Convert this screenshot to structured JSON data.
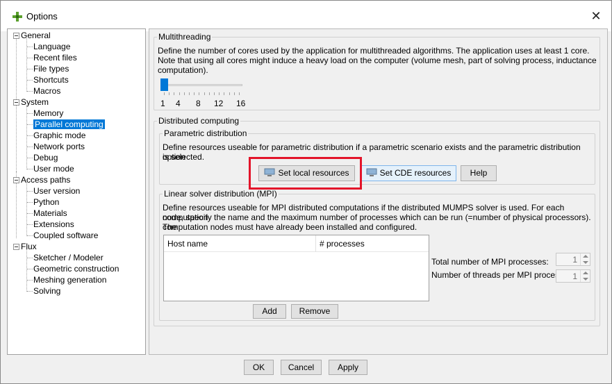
{
  "window": {
    "title": "Options",
    "close_glyph": "✕"
  },
  "tree": {
    "items": [
      {
        "label": "General",
        "level": 0
      },
      {
        "label": "Language",
        "level": 1
      },
      {
        "label": "Recent files",
        "level": 1
      },
      {
        "label": "File types",
        "level": 1
      },
      {
        "label": "Shortcuts",
        "level": 1
      },
      {
        "label": "Macros",
        "level": 1
      },
      {
        "label": "System",
        "level": 0
      },
      {
        "label": "Memory",
        "level": 1
      },
      {
        "label": "Parallel computing",
        "level": 1,
        "selected": true
      },
      {
        "label": "Graphic mode",
        "level": 1
      },
      {
        "label": "Network ports",
        "level": 1
      },
      {
        "label": "Debug",
        "level": 1
      },
      {
        "label": "User mode",
        "level": 1
      },
      {
        "label": "Access paths",
        "level": 0
      },
      {
        "label": "User version",
        "level": 1
      },
      {
        "label": "Python",
        "level": 1
      },
      {
        "label": "Materials",
        "level": 1
      },
      {
        "label": "Extensions",
        "level": 1
      },
      {
        "label": "Coupled software",
        "level": 1
      },
      {
        "label": "Flux",
        "level": 0
      },
      {
        "label": "Sketcher / Modeler",
        "level": 1
      },
      {
        "label": "Geometric construction",
        "level": 1
      },
      {
        "label": "Meshing generation",
        "level": 1
      },
      {
        "label": "Solving",
        "level": 1
      }
    ]
  },
  "multithreading": {
    "legend": "Multithreading",
    "line1": "Define the number of cores used by the application for multithreaded algorithms. The application uses at least 1 core.",
    "line2": "Note that using all cores might induce a heavy load on the computer (volume mesh, part of solving process, inductance",
    "line3": "computation).",
    "slider": {
      "value": 1,
      "min": 1,
      "max": 16,
      "tick_labels": [
        "1",
        "4",
        "8",
        "12",
        "16"
      ]
    }
  },
  "distributed": {
    "legend": "Distributed computing",
    "parametric": {
      "legend": "Parametric distribution",
      "line1": "Define resources useable for parametric distribution if a parametric scenario exists and the parametric distribution option",
      "line2": "is selected.",
      "set_local_label": "Set local resources",
      "set_cde_label": "Set CDE resources",
      "help_label": "Help"
    },
    "mpi": {
      "legend": "Linear solver distribution (MPI)",
      "line1": "Define resources useable for MPI distributed computations if the distributed MUMPS solver is used. For each computation",
      "line2": "node, specify the name and the maximum number of processes which can be run (=number of physical processors). The",
      "line3": "computation nodes must have already been installed and configured.",
      "columns": [
        "Host name",
        "# processes"
      ],
      "add_label": "Add",
      "remove_label": "Remove",
      "total_label": "Total number of MPI processes:",
      "total_value": "1",
      "threads_label": "Number of threads per MPI process:",
      "threads_value": "1"
    }
  },
  "footer": {
    "ok_label": "OK",
    "cancel_label": "Cancel",
    "apply_label": "Apply"
  },
  "colors": {
    "selection": "#0078d7",
    "highlight": "#e3142a",
    "slider": "#0078d7"
  }
}
